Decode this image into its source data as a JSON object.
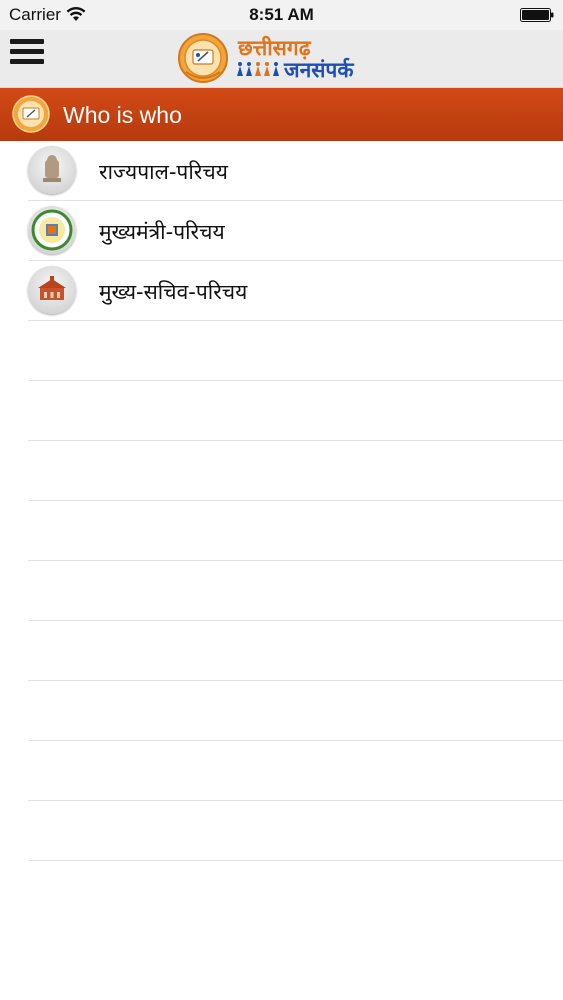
{
  "status_bar": {
    "carrier": "Carrier",
    "time": "8:51 AM"
  },
  "header": {
    "logo_line1": "छत्तीसगढ़",
    "logo_line2": "जनसंपर्क",
    "brand_orange": "#e2731a",
    "brand_blue": "#1e4fb8"
  },
  "section": {
    "title": "Who is who",
    "color": "#c4420f"
  },
  "list": {
    "items": [
      {
        "label": "राज्यपाल-परिचय",
        "icon": "emblem-icon"
      },
      {
        "label": "मुख्यमंत्री-परिचय",
        "icon": "state-seal-icon"
      },
      {
        "label": "मुख्य-सचिव-परिचय",
        "icon": "secretariat-icon"
      }
    ]
  }
}
